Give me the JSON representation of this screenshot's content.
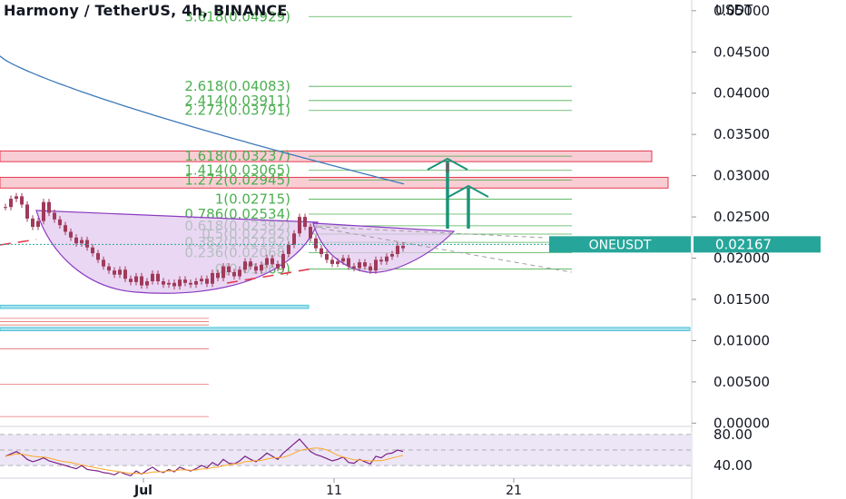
{
  "header": {
    "title": "Harmony / TetherUS, 4h, BINANCE",
    "currency": "USDT"
  },
  "colors": {
    "fib_line": "#4caf50",
    "fib_text": "#4caf50",
    "zone_fill": "#f7c6cc",
    "zone_stroke": "#e53950",
    "support_fill": "#a5e1ec",
    "support_stroke": "#4fc3d8",
    "ma": "#3d7ab8",
    "cup_fill": "#e1c6ee",
    "cup_stroke": "#8a3cc0",
    "candle": "#a03a5a",
    "arrow": "#1a9478",
    "arrow_gray": "#616161",
    "trend": "#e5394f",
    "price_label": "#26a69a",
    "rsi_bg": "#ece6f6",
    "rsi_line": "#7a1f86",
    "rsi_ma": "#ffa726"
  },
  "chart_data": {
    "type": "candlestick",
    "symbol": "ONEUSDT",
    "last_price": "0.02167",
    "price_axis": {
      "ylim": [
        -0.0004,
        0.0513
      ],
      "ticks": [
        "0.05000",
        "0.04500",
        "0.04000",
        "0.03500",
        "0.03000",
        "0.02500",
        "0.02000",
        "0.01500",
        "0.01000",
        "0.00500",
        "0.00000"
      ],
      "tick_values": [
        0.05,
        0.045,
        0.04,
        0.035,
        0.03,
        0.025,
        0.02,
        0.015,
        0.01,
        0.005,
        0.0
      ]
    },
    "time_axis": {
      "labels": [
        "Jul",
        "11",
        "21"
      ]
    },
    "fibonacci_levels": [
      {
        "label": "3.618(0.04929)",
        "price": 0.04929
      },
      {
        "label": "2.618(0.04083)",
        "price": 0.04083
      },
      {
        "label": "2.414(0.03911)",
        "price": 0.03911
      },
      {
        "label": "2.272(0.03791)",
        "price": 0.03791
      },
      {
        "label": "1.618(0.03237)",
        "price": 0.03237
      },
      {
        "label": "1.414(0.03065)",
        "price": 0.03065
      },
      {
        "label": "1.272(0.02945)",
        "price": 0.02945
      },
      {
        "label": "1(0.02715)",
        "price": 0.02715
      },
      {
        "label": "0.786(0.02534)",
        "price": 0.02534
      },
      {
        "label": "0.618(0.02392)",
        "price": 0.02392
      },
      {
        "label": "0.5(0.02292)",
        "price": 0.02292
      },
      {
        "label": "0.382(0.02192)",
        "price": 0.02192
      },
      {
        "label": "0.236(0.02068)",
        "price": 0.02068
      },
      {
        "label": "0(0.01869)",
        "price": 0.01869
      }
    ],
    "resistance_zones": [
      {
        "top": 0.033,
        "bottom": 0.0317
      },
      {
        "top": 0.0298,
        "bottom": 0.0285
      }
    ],
    "support_zones": [
      {
        "top": 0.0143,
        "bottom": 0.0139
      },
      {
        "top": 0.0116,
        "bottom": 0.0112
      }
    ],
    "close_prices": [
      0.0262,
      0.0272,
      0.0275,
      0.0265,
      0.0248,
      0.0238,
      0.0245,
      0.0268,
      0.0255,
      0.0247,
      0.024,
      0.0232,
      0.0225,
      0.0218,
      0.0222,
      0.0213,
      0.0206,
      0.0198,
      0.019,
      0.0185,
      0.018,
      0.0186,
      0.0175,
      0.0171,
      0.0178,
      0.0167,
      0.0172,
      0.0181,
      0.0172,
      0.0168,
      0.017,
      0.0166,
      0.0174,
      0.017,
      0.0168,
      0.0172,
      0.0175,
      0.0169,
      0.0182,
      0.0176,
      0.019,
      0.0183,
      0.0178,
      0.0186,
      0.0196,
      0.019,
      0.0185,
      0.0192,
      0.02,
      0.0193,
      0.0188,
      0.0205,
      0.0216,
      0.023,
      0.025,
      0.0238,
      0.0224,
      0.0212,
      0.0205,
      0.0198,
      0.0193,
      0.0196,
      0.02,
      0.019,
      0.0188,
      0.0195,
      0.019,
      0.0185,
      0.0198,
      0.0196,
      0.0202,
      0.0205,
      0.0215,
      0.0212
    ],
    "rsi": {
      "ticks": [
        "80.00",
        "40.00"
      ],
      "tick_values": [
        80,
        40
      ],
      "ylim": [
        25,
        88
      ],
      "values": [
        52,
        55,
        58,
        54,
        48,
        45,
        47,
        50,
        46,
        44,
        42,
        40,
        38,
        36,
        40,
        35,
        34,
        33,
        31,
        30,
        28,
        32,
        29,
        27,
        33,
        29,
        34,
        38,
        33,
        31,
        35,
        32,
        38,
        35,
        33,
        36,
        40,
        37,
        44,
        40,
        48,
        43,
        42,
        46,
        52,
        48,
        45,
        50,
        56,
        52,
        48,
        56,
        62,
        68,
        74,
        66,
        58,
        54,
        52,
        49,
        46,
        48,
        51,
        44,
        43,
        48,
        45,
        42,
        52,
        50,
        55,
        56,
        60,
        58
      ]
    }
  }
}
